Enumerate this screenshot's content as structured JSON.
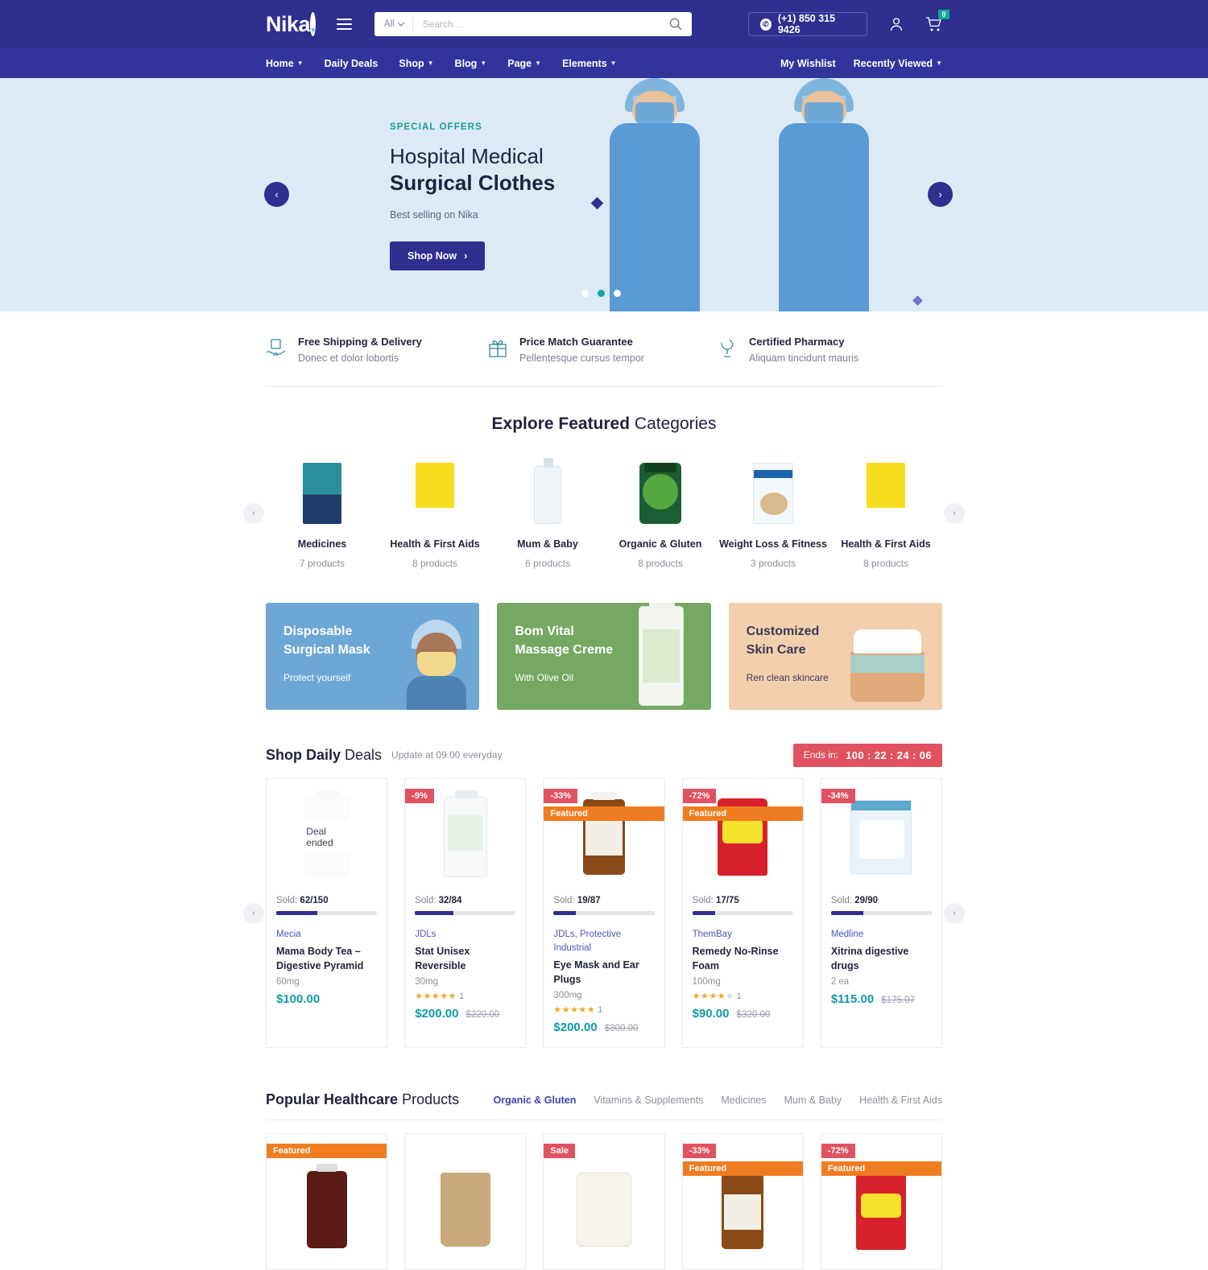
{
  "header": {
    "logo": "Nika",
    "logo_dot": ".",
    "menu_icon": "hamburger-icon",
    "search": {
      "category": "All",
      "placeholder": "Search ...",
      "value": ""
    },
    "phone": "(+1) 850 315 9426",
    "account_icon": "user-icon",
    "cart_icon": "cart-icon",
    "cart_count": "0"
  },
  "nav": {
    "left": [
      {
        "label": "Home",
        "caret": true
      },
      {
        "label": "Daily Deals",
        "caret": false
      },
      {
        "label": "Shop",
        "caret": true
      },
      {
        "label": "Blog",
        "caret": true
      },
      {
        "label": "Page",
        "caret": true
      },
      {
        "label": "Elements",
        "caret": true
      }
    ],
    "right": [
      {
        "label": "My Wishlist",
        "caret": false
      },
      {
        "label": "Recently Viewed",
        "caret": true
      }
    ]
  },
  "hero": {
    "eyebrow": "SPECIAL OFFERS",
    "title_line1": "Hospital Medical",
    "title_line2": "Surgical Clothes",
    "subtitle": "Best selling on Nika",
    "cta": "Shop Now",
    "cta_arrow": "›",
    "prev": "‹",
    "next": "›",
    "active_dot": 1,
    "dot_count": 3,
    "bg": "#dceaf5",
    "accent": "#16a79b"
  },
  "features": [
    {
      "icon": "hand-package-icon",
      "title": "Free Shipping & Delivery",
      "sub": "Donec et dolor lobortis"
    },
    {
      "icon": "gift-icon",
      "title": "Price Match Guarantee",
      "sub": "Pellentesque cursus tempor"
    },
    {
      "icon": "mortar-pestle-icon",
      "title": "Certified Pharmacy",
      "sub": "Aliquam tincidunt mauris"
    }
  ],
  "categories_section": {
    "title_bold": "Explore Featured",
    "title_light": " Categories",
    "prev": "‹",
    "next": "›",
    "items": [
      {
        "name": "Medicines",
        "count": "7 products",
        "art": "kp"
      },
      {
        "name": "Health & First Aids",
        "count": "8 products",
        "art": "yl"
      },
      {
        "name": "Mum & Baby",
        "count": "6 products",
        "art": "bottle"
      },
      {
        "name": "Organic & Gluten",
        "count": "8 products",
        "art": "jar"
      },
      {
        "name": "Weight Loss & Fitness",
        "count": "3 products",
        "art": "shake"
      },
      {
        "name": "Health & First Aids",
        "count": "8 products",
        "art": "yl"
      }
    ]
  },
  "promos": [
    {
      "title_l1": "Disposable",
      "title_l2": "Surgical Mask",
      "sub": "Protect yourself",
      "color": "#6ea7d6",
      "art": "nurse"
    },
    {
      "title_l1": "Bom Vital",
      "title_l2": "Massage Creme",
      "sub": "With Olive Oil",
      "color": "#75a862",
      "art": "creme"
    },
    {
      "title_l1": "Customized",
      "title_l2": "Skin Care",
      "sub": "Ren clean skincare",
      "color": "#f3cfad",
      "art": "skin"
    }
  ],
  "deals": {
    "title_bold": "Shop Daily",
    "title_light": " Deals",
    "subtitle": "Update at 09:00 everyday",
    "timer_label": "Ends in:",
    "timer_value": "100 : 22 : 24 : 06",
    "prev": "‹",
    "next": "›",
    "products": [
      {
        "badges": [],
        "overlay": "Deal ended",
        "sold_label": "Sold:",
        "sold_value": "62/150",
        "progress": 41,
        "brand": "Mecia",
        "name": "Mama Body Tea – Digestive Pyramid",
        "dose": "60mg",
        "rating": 0,
        "rating_count": "",
        "price": "$100.00",
        "old_price": "",
        "art": "pill-bottle"
      },
      {
        "badges": [
          {
            "text": "-9%",
            "kind": "pct"
          }
        ],
        "overlay": "",
        "sold_label": "Sold:",
        "sold_value": "32/84",
        "progress": 38,
        "brand": "JDLs",
        "name": "Stat Unisex Reversible",
        "dose": "30mg",
        "rating": 5,
        "rating_count": "1",
        "price": "$200.00",
        "old_price": "$220.00",
        "art": "protein"
      },
      {
        "badges": [
          {
            "text": "-33%",
            "kind": "pct"
          },
          {
            "text": "Featured",
            "kind": "feat"
          }
        ],
        "overlay": "",
        "sold_label": "Sold:",
        "sold_value": "19/87",
        "progress": 22,
        "brand": "JDLs, Protective Industrial",
        "name": "Eye Mask and Ear Plugs",
        "dose": "300mg",
        "rating": 5,
        "rating_count": "1",
        "price": "$200.00",
        "old_price": "$300.00",
        "art": "amber"
      },
      {
        "badges": [
          {
            "text": "-72%",
            "kind": "pct"
          },
          {
            "text": "Featured",
            "kind": "feat"
          }
        ],
        "overlay": "",
        "sold_label": "Sold:",
        "sold_value": "17/75",
        "progress": 23,
        "brand": "ThemBay",
        "name": "Remedy No-Rinse Foam",
        "dose": "100mg",
        "rating": 4,
        "rating_count": "1",
        "price": "$90.00",
        "old_price": "$320.00",
        "art": "redpack"
      },
      {
        "badges": [
          {
            "text": "-34%",
            "kind": "pct"
          }
        ],
        "overlay": "",
        "sold_label": "Sold:",
        "sold_value": "29/90",
        "progress": 32,
        "brand": "Medline",
        "name": "Xitrina digestive drugs",
        "dose": "2 ea",
        "rating": 0,
        "rating_count": "",
        "price": "$115.00",
        "old_price": "$175.07",
        "art": "diaper"
      }
    ]
  },
  "popular": {
    "title_bold": "Popular Healthcare",
    "title_light": " Products",
    "tabs": [
      {
        "label": "Organic & Gluten",
        "active": true
      },
      {
        "label": "Vitamins & Supplements",
        "active": false
      },
      {
        "label": "Medicines",
        "active": false
      },
      {
        "label": "Mum & Baby",
        "active": false
      },
      {
        "label": "Health & First Aids",
        "active": false
      }
    ],
    "products": [
      {
        "badges": [
          {
            "text": "Featured",
            "kind": "feat-top"
          }
        ],
        "art": "go"
      },
      {
        "badges": [],
        "art": "eto"
      },
      {
        "badges": [
          {
            "text": "Sale",
            "kind": "sale"
          }
        ],
        "art": "natura"
      },
      {
        "badges": [
          {
            "text": "-33%",
            "kind": "pct"
          },
          {
            "text": "Featured",
            "kind": "feat"
          }
        ],
        "art": "amber"
      },
      {
        "badges": [
          {
            "text": "-72%",
            "kind": "pct"
          },
          {
            "text": "Featured",
            "kind": "feat"
          }
        ],
        "art": "redpack"
      }
    ]
  }
}
